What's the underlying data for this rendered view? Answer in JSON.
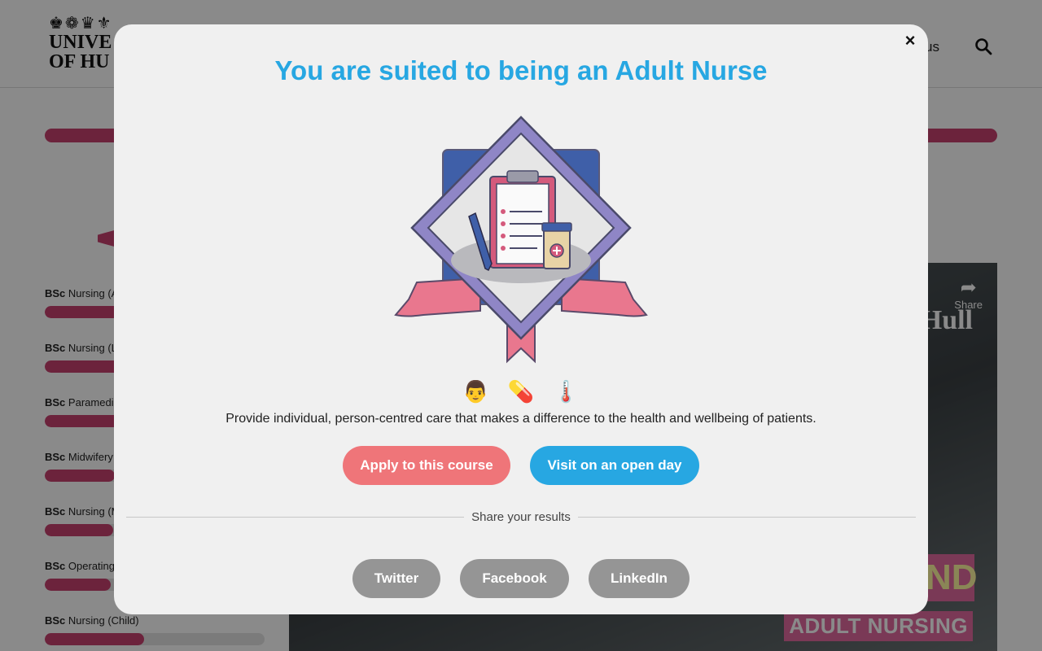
{
  "background": {
    "logo": {
      "crest": "♚❁♛⚜",
      "line1": "UNIVE",
      "line2": "OF HU"
    },
    "nav_fragment": "us",
    "course_list": [
      {
        "prefix": "BSc",
        "label": "Nursing (A",
        "fill": 0.42
      },
      {
        "prefix": "BSc",
        "label": "Nursing (L",
        "fill": 0.36
      },
      {
        "prefix": "BSc",
        "label": "Paramedic",
        "fill": 0.34
      },
      {
        "prefix": "BSc",
        "label": "Midwifery",
        "fill": 0.32
      },
      {
        "prefix": "BSc",
        "label": "Nursing (M",
        "fill": 0.31
      },
      {
        "prefix": "BSc",
        "label": "Operating",
        "fill": 0.3
      },
      {
        "prefix": "BSc",
        "label": "Nursing (Child)",
        "fill": 0.45
      }
    ],
    "video": {
      "share_label": "Share",
      "brand_fragment": "Hull",
      "overlay_fragment": "ND",
      "overlay_caption": "ADULT NURSING"
    }
  },
  "modal": {
    "title": "You are suited to being an Adult Nurse",
    "emojis": [
      "👨",
      "💊",
      "🌡️"
    ],
    "description": "Provide individual, person-centred care that makes a difference to the health and wellbeing of patients.",
    "apply_label": "Apply to this course",
    "open_day_label": "Visit on an open day",
    "share_label": "Share your results",
    "social": {
      "twitter": "Twitter",
      "facebook": "Facebook",
      "linkedin": "LinkedIn"
    },
    "close_symbol": "×"
  },
  "colors": {
    "accent_blue": "#27a7e2",
    "apply_red": "#ef7579",
    "progress_pink": "#c8426f",
    "social_grey": "#959595"
  }
}
